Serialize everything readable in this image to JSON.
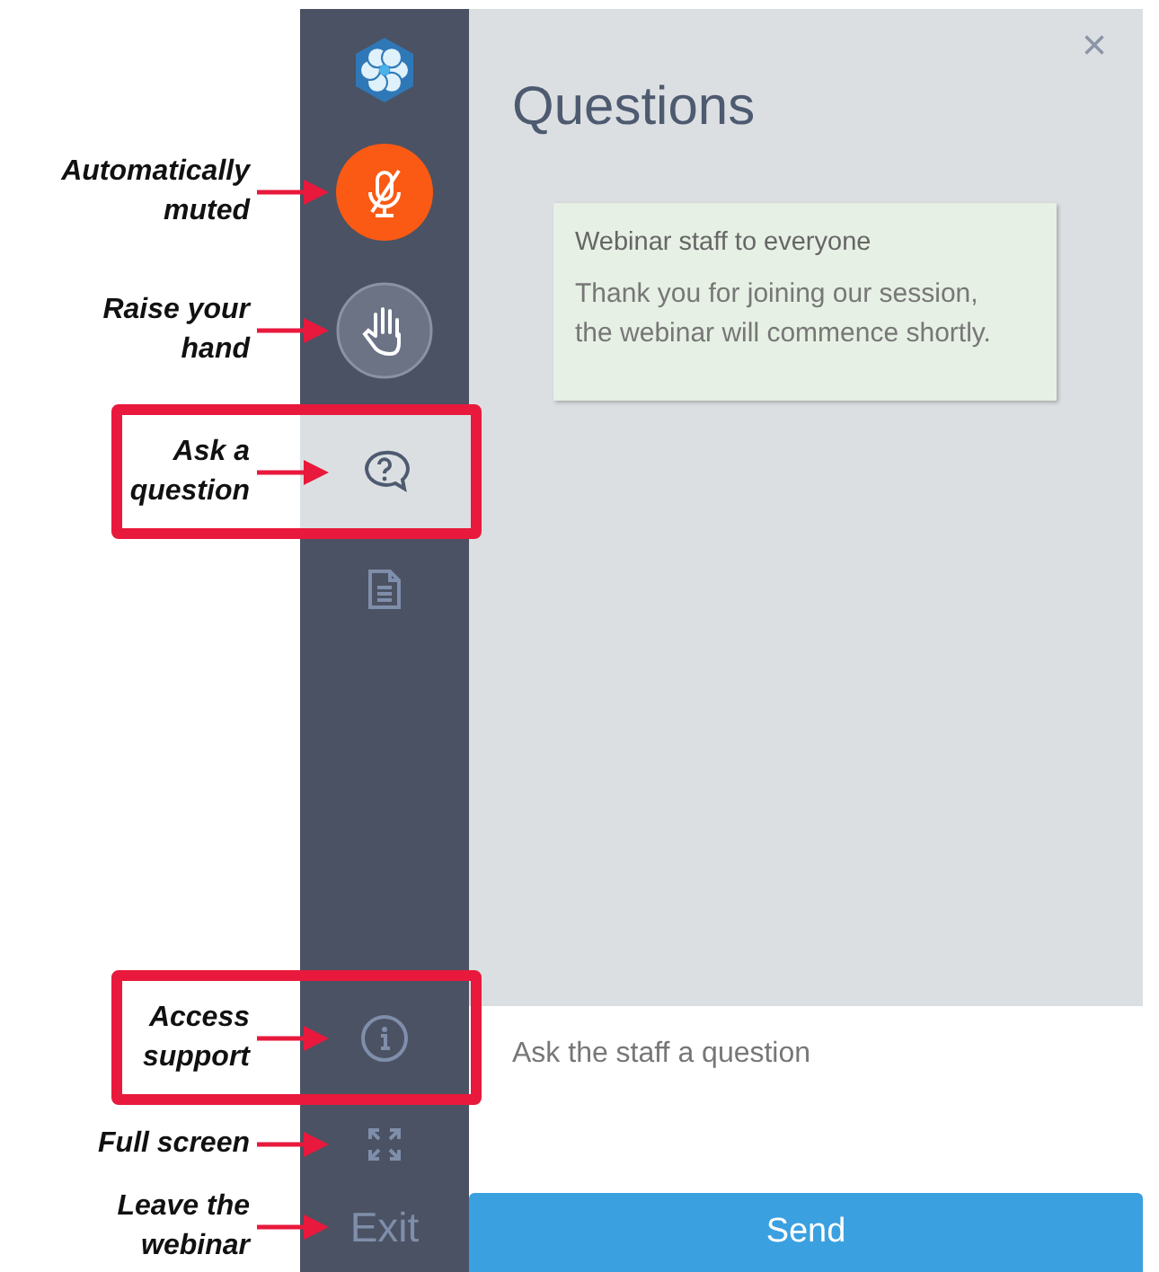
{
  "sidebar": {
    "items": [
      {
        "kind": "logo",
        "selected": false
      },
      {
        "kind": "mic",
        "muted": true,
        "selected": false,
        "annotation": "Automatically\nmuted"
      },
      {
        "kind": "hand",
        "selected": false,
        "annotation": "Raise your\nhand"
      },
      {
        "kind": "question",
        "selected": true,
        "highlighted": true,
        "annotation": "Ask a\nquestion"
      },
      {
        "kind": "document",
        "selected": false
      },
      {
        "kind": "spacer"
      },
      {
        "kind": "info",
        "selected": false,
        "highlighted": true,
        "annotation": "Access\nsupport"
      },
      {
        "kind": "fullscreen",
        "selected": false,
        "annotation": "Full screen"
      },
      {
        "kind": "exit",
        "label": "Exit",
        "selected": false,
        "annotation": "Leave the\nwebinar"
      }
    ]
  },
  "panel": {
    "title": "Questions",
    "close": "×",
    "messages": [
      {
        "sender": "Webinar staff to everyone",
        "text": "Thank you for joining our session, the webinar will commence shortly."
      }
    ],
    "input": {
      "placeholder": "Ask the staff a question"
    },
    "send_button": "Send"
  }
}
